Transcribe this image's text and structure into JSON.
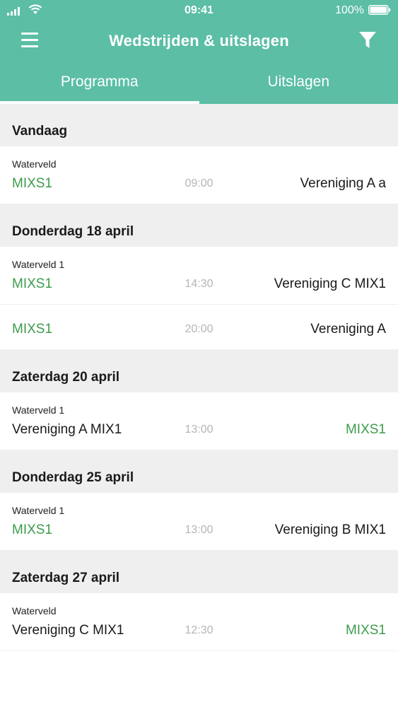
{
  "status_bar": {
    "time": "09:41",
    "battery": "100%"
  },
  "header": {
    "title": "Wedstrijden & uitslagen"
  },
  "tabs": [
    {
      "label": "Programma",
      "active": true
    },
    {
      "label": "Uitslagen",
      "active": false
    }
  ],
  "colors": {
    "header_bg": "#5bbea5",
    "own_team": "#3c9c4c",
    "time": "#b5b5b5",
    "section_bg": "#efefef"
  },
  "days": [
    {
      "label": "Vandaag",
      "matches": [
        {
          "venue": "Waterveld",
          "home": "MIXS1",
          "time": "09:00",
          "away": "Vereniging A a"
        }
      ]
    },
    {
      "label": "Donderdag 18 april",
      "matches": [
        {
          "venue": "Waterveld 1",
          "home": "MIXS1",
          "time": "14:30",
          "away": "Vereniging C MIX1"
        },
        {
          "venue": "",
          "home": "MIXS1",
          "time": "20:00",
          "away": "Vereniging A"
        }
      ]
    },
    {
      "label": "Zaterdag 20 april",
      "matches": [
        {
          "venue": "Waterveld 1",
          "home": "Vereniging A MIX1",
          "time": "13:00",
          "away": "MIXS1"
        }
      ]
    },
    {
      "label": "Donderdag 25 april",
      "matches": [
        {
          "venue": "Waterveld 1",
          "home": "MIXS1",
          "time": "13:00",
          "away": "Vereniging B MIX1"
        }
      ]
    },
    {
      "label": "Zaterdag 27 april",
      "matches": [
        {
          "venue": "Waterveld",
          "home": "Vereniging C MIX1",
          "time": "12:30",
          "away": "MIXS1"
        }
      ]
    }
  ]
}
